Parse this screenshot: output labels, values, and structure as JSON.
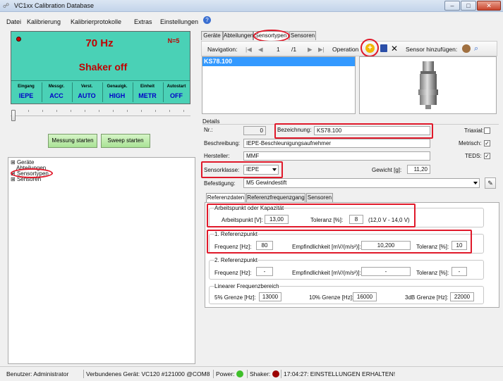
{
  "window": {
    "title": "VC1xx Calibration Database"
  },
  "menu": [
    "Datei",
    "Kalibrierung",
    "Kalibrierprotokolle",
    "Extras",
    "Einstellungen"
  ],
  "lcd": {
    "frequency": "70 Hz",
    "n": "N=5",
    "status": "Shaker off",
    "columns": [
      {
        "head": "Eingang",
        "value": "IEPE"
      },
      {
        "head": "Messgr.",
        "value": "ACC"
      },
      {
        "head": "Verst.",
        "value": "AUTO"
      },
      {
        "head": "Genauigk.",
        "value": "HIGH"
      },
      {
        "head": "Einheit",
        "value": "METR"
      },
      {
        "head": "Autostart",
        "value": "OFF"
      }
    ]
  },
  "buttons": {
    "messung": "Messung starten",
    "sweep": "Sweep starten"
  },
  "tree": {
    "geraete": "Geräte",
    "abteilungen": "Abteilungen",
    "sensortypen": "Sensortypen",
    "sensoren": "Sensoren"
  },
  "tabs": [
    "Geräte",
    "Abteilungen",
    "Sensortypen",
    "Sensoren"
  ],
  "toolbar": {
    "navigation": "Navigation:",
    "page": "1",
    "of": "/1",
    "operation": "Operation",
    "add_sensor": "Sensor hinzufügen:"
  },
  "list": {
    "selected": "KS78.100"
  },
  "details": {
    "title": "Details",
    "nr_label": "Nr.:",
    "nr_value": "0",
    "bezeichnung_label": "Bezeichnung:",
    "bezeichnung_value": "KS78.100",
    "triaxial_label": "Triaxial:",
    "beschreibung_label": "Beschreibung:",
    "beschreibung_value": "IEPE-Beschleunigungsaufnehmer",
    "metrisch_label": "Metrisch:",
    "hersteller_label": "Hersteller:",
    "hersteller_value": "MMF",
    "teds_label": "TEDS:",
    "sensorklasse_label": "Sensorklasse:",
    "sensorklasse_value": "IEPE",
    "gewicht_label": "Gewicht [g]:",
    "gewicht_value": "11,20",
    "befestigung_label": "Befestigung:",
    "befestigung_value": "M5 Gewindestift"
  },
  "subtabs": [
    "Referenzdaten",
    "Referenzfrequenzgang",
    "Sensoren"
  ],
  "arbeitspunkt": {
    "title": "Arbeitspunkt oder Kapazität",
    "ap_label": "Arbeitspunkt [V]:",
    "ap_value": "13,00",
    "tol_label": "Toleranz [%]:",
    "tol_value": "8",
    "range": "(12,0 V - 14,0 V)"
  },
  "ref1": {
    "title": "1. Referenzpunkt",
    "freq_label": "Frequenz [Hz]:",
    "freq_value": "80",
    "emp_label": "Empfindlichkeit [mV/(m/s²)]:",
    "emp_value": "10,200",
    "tol_label": "Toleranz [%]:",
    "tol_value": "10"
  },
  "ref2": {
    "title": "2. Referenzpunkt",
    "freq_label": "Frequenz [Hz]:",
    "freq_value": "-",
    "emp_label": "Empfindlichkeit [mV/(m/s²)]:",
    "emp_value": "-",
    "tol_label": "Toleranz [%]:",
    "tol_value": "-"
  },
  "linear": {
    "title": "Linearer Frequenzbereich",
    "g5_label": "5% Grenze [Hz]:",
    "g5_value": "13000",
    "g10_label": "10% Grenze [Hz]:",
    "g10_value": "16000",
    "g3db_label": "3dB Grenze [Hz]:",
    "g3db_value": "22000"
  },
  "status": {
    "user": "Benutzer: Administrator",
    "device": "Verbundenes Gerät: VC120 #121000 @COM8",
    "power": "Power:",
    "shaker": "Shaker:",
    "message": "17:04:27: EINSTELLUNGEN ERHALTEN!"
  },
  "colors": {
    "lcd": "#4ad1b6",
    "highlight": "#e0192a",
    "selection": "#3399ff"
  }
}
